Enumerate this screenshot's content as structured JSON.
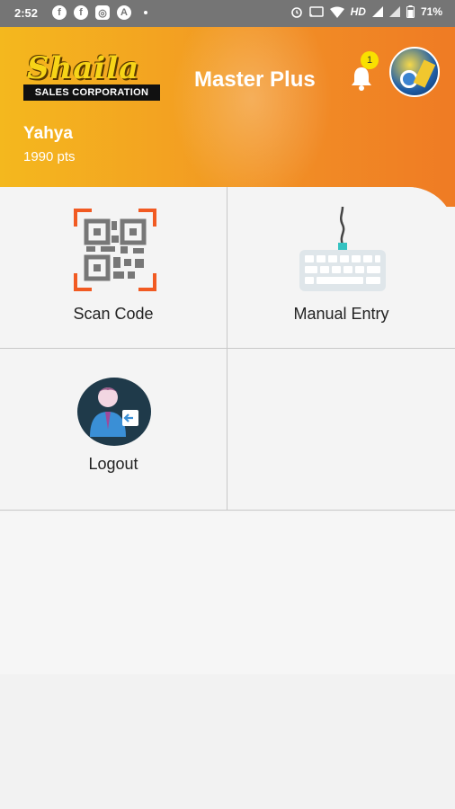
{
  "status_bar": {
    "time": "2:52",
    "left_icons": [
      "facebook-icon",
      "facebook-icon",
      "instagram-icon",
      "a-icon"
    ],
    "network_label": "HD",
    "battery": "71%"
  },
  "header": {
    "logo_brand": "Shaila",
    "logo_sub": "SALES CORPORATION",
    "app_title": "Master Plus",
    "notification_count": "1",
    "user_name": "Yahya",
    "user_points": "1990 pts"
  },
  "menu": {
    "items": [
      {
        "label": "Scan Code",
        "icon": "qr-scan-icon"
      },
      {
        "label": "Manual Entry",
        "icon": "keyboard-icon"
      },
      {
        "label": "Logout",
        "icon": "logout-icon"
      }
    ]
  },
  "colors": {
    "header_start": "#f4b81e",
    "header_end": "#ef7b24",
    "scan_corner": "#f15a22",
    "keyboard_accent": "#35c2c1",
    "logout_bg": "#1f3a4a"
  }
}
